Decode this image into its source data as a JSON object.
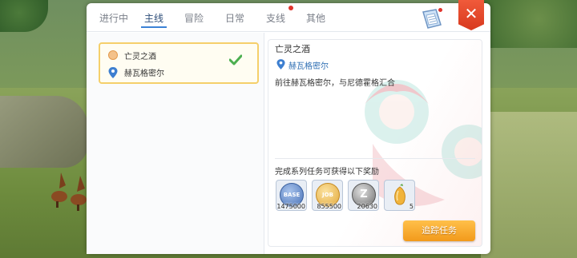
{
  "tabs": [
    {
      "label": "进行中",
      "active": false,
      "badge": false
    },
    {
      "label": "主线",
      "active": true,
      "badge": false
    },
    {
      "label": "冒险",
      "active": false,
      "badge": false
    },
    {
      "label": "日常",
      "active": false,
      "badge": false
    },
    {
      "label": "支线",
      "active": false,
      "badge": true
    },
    {
      "label": "其他",
      "active": false,
      "badge": false
    }
  ],
  "close_label": "✕",
  "quest_list": [
    {
      "name": "亡灵之酒",
      "location": "赫瓦格密尔",
      "completed": true
    }
  ],
  "detail": {
    "title": "亡灵之酒",
    "location": "赫瓦格密尔",
    "description": "前往赫瓦格密尔，与尼德霍格汇合",
    "reward_title": "完成系列任务可获得以下奖励",
    "rewards": [
      {
        "icon": "base-exp-coin-icon",
        "coin_label": "BASE",
        "amount": "1475000",
        "color": "#5b86c9"
      },
      {
        "icon": "job-exp-coin-icon",
        "coin_label": "JOB",
        "amount": "855500",
        "color": "#e8b94a"
      },
      {
        "icon": "zeny-coin-icon",
        "coin_label": "Z",
        "amount": "20630",
        "color": "#7d7d7d"
      },
      {
        "icon": "fruit-item-icon",
        "coin_label": "",
        "amount": "5",
        "color": "#f0b53a"
      }
    ],
    "track_button": "追踪任务"
  },
  "colors": {
    "accent": "#3b82d6",
    "close": "#e0472a",
    "track_button": "#f5a623",
    "badge": "#e0332b"
  }
}
